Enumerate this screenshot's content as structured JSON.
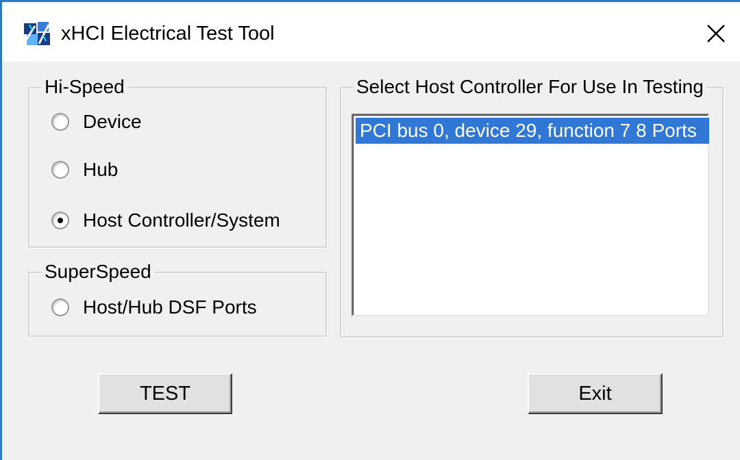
{
  "window": {
    "title": "xHCI Electrical Test Tool",
    "icon": "app-icon",
    "accent_color": "#2b79c9"
  },
  "hi_speed": {
    "label": "Hi-Speed",
    "options": [
      {
        "label": "Device",
        "checked": false
      },
      {
        "label": "Hub",
        "checked": false
      },
      {
        "label": "Host Controller/System",
        "checked": true
      }
    ]
  },
  "super_speed": {
    "label": "SuperSpeed",
    "options": [
      {
        "label": "Host/Hub DSF Ports",
        "checked": false
      }
    ]
  },
  "host_controller": {
    "label": "Select Host Controller For Use In Testing",
    "items": [
      {
        "text": "PCI bus 0, device 29, function 7  8 Ports",
        "selected": true
      }
    ],
    "selection_color": "#3077d6"
  },
  "buttons": {
    "test_label": "TEST",
    "exit_label": "Exit"
  }
}
